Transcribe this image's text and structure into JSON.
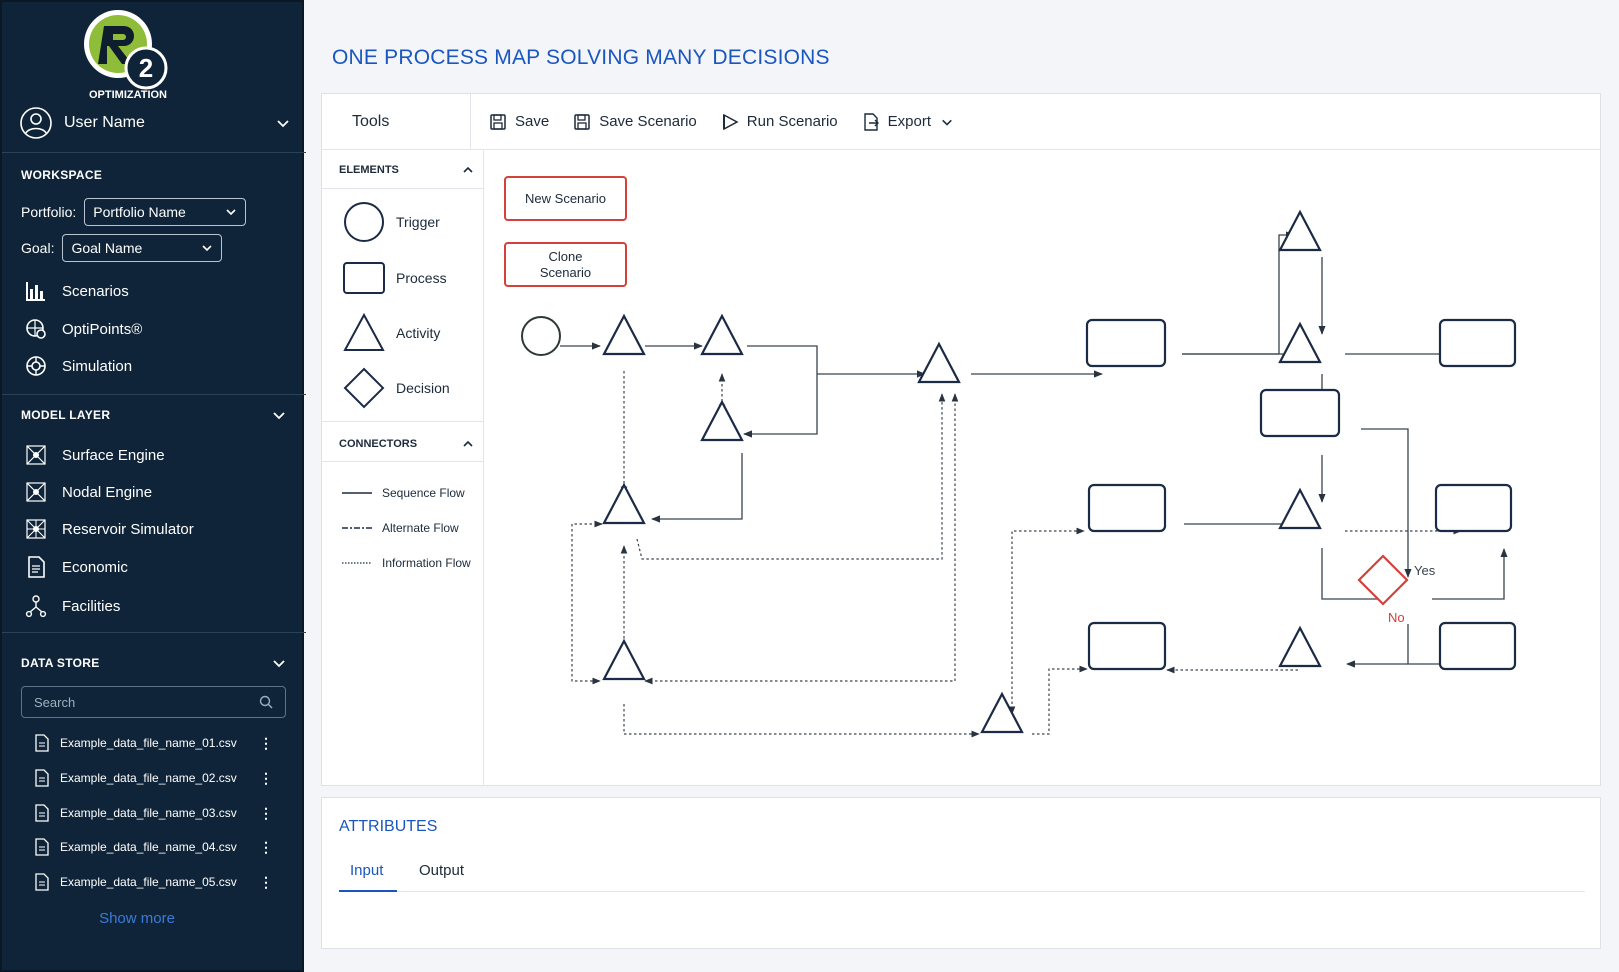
{
  "app": {
    "logo_text": "OPTIMIZATION",
    "logo_letters": "R2"
  },
  "user": {
    "name": "User Name"
  },
  "workspace": {
    "heading": "WORKSPACE",
    "portfolio_label": "Portfolio:",
    "portfolio_value": "Portfolio Name",
    "goal_label": "Goal:",
    "goal_value": "Goal Name",
    "items": [
      {
        "label": "Scenarios",
        "icon": "bar-chart-icon"
      },
      {
        "label": "OptiPoints®",
        "icon": "optipoints-icon"
      },
      {
        "label": "Simulation",
        "icon": "simulation-icon"
      }
    ]
  },
  "model_layer": {
    "heading": "MODEL LAYER",
    "items": [
      {
        "label": "Surface Engine",
        "icon": "network-icon"
      },
      {
        "label": "Nodal Engine",
        "icon": "network-icon"
      },
      {
        "label": "Reservoir Simulator",
        "icon": "network-icon"
      },
      {
        "label": "Economic",
        "icon": "document-icon"
      },
      {
        "label": "Facilities",
        "icon": "facilities-icon"
      }
    ]
  },
  "data_store": {
    "heading": "DATA STORE",
    "search_placeholder": "Search",
    "files": [
      "Example_data_file_name_01.csv",
      "Example_data_file_name_02.csv",
      "Example_data_file_name_03.csv",
      "Example_data_file_name_04.csv",
      "Example_data_file_name_05.csv"
    ],
    "show_more": "Show more"
  },
  "main": {
    "title": "ONE PROCESS MAP SOLVING MANY DECISIONS",
    "toolbar": {
      "tools_label": "Tools",
      "save": "Save",
      "save_scenario": "Save Scenario",
      "run_scenario": "Run Scenario",
      "export": "Export"
    },
    "elements": {
      "heading": "ELEMENTS",
      "items": [
        "Trigger",
        "Process",
        "Activity",
        "Decision"
      ]
    },
    "connectors": {
      "heading": "CONNECTORS",
      "items": [
        "Sequence Flow",
        "Alternate Flow",
        "Information Flow"
      ]
    },
    "scenario_buttons": {
      "new": "New Scenario",
      "clone_line1": "Clone",
      "clone_line2": "Scenario"
    },
    "decision_labels": {
      "yes": "Yes",
      "no": "No"
    }
  },
  "attributes": {
    "title": "ATTRIBUTES",
    "tabs": [
      "Input",
      "Output"
    ],
    "active_tab": "Input"
  },
  "colors": {
    "sidebar_bg": "#0f2438",
    "accent_blue": "#1a56c0",
    "scenario_red": "#d4403a",
    "shape_navy": "#1b2a45"
  }
}
